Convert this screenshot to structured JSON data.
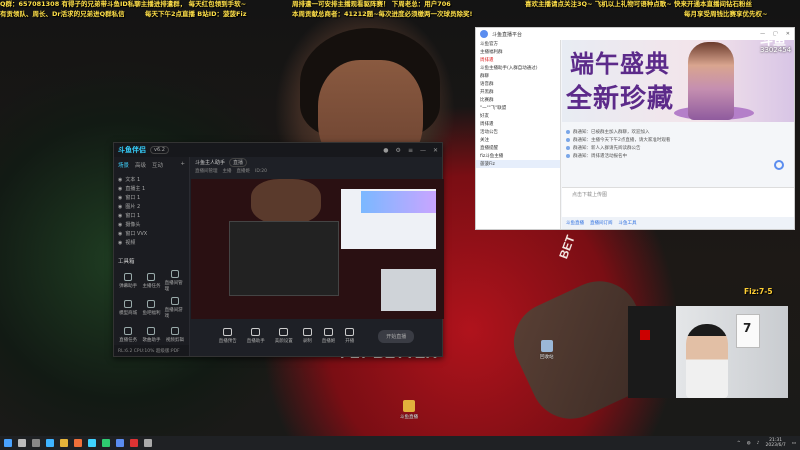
{
  "ticker": {
    "line1_left": "Q群：657081308 有得子的兄弟带斗鱼ID私聊主播进排遣群， 每天红包领到手软~",
    "line1_mid": "周排遣一可安排主播观看驱阵赛！ 下周老总：用户706",
    "line1_right": "喜欢主播请点关注3Q~ 飞机以上礼物可语种点歌~ 快来开通本直播间钻石粉丝",
    "line2_left": "有贡领队、周长、Dr活求的兄弟进Q群私信",
    "line2_mid": "每天下午2点直播 B站ID：菠菠Fiz",
    "line2_mid2": "本周贡献总商者：41212题~每次进度必须缴两一次球员除奖!",
    "line2_right": "每月享受周钱比赛享优先权~"
  },
  "app": {
    "logo": "斗鱼伴侣",
    "version": "v6.2",
    "tabs": [
      "场景",
      "高级",
      "互动"
    ],
    "scenes": [
      "文本 1",
      "直播主 1",
      "窗口 1",
      "图片 2",
      "窗口 1",
      "摄像头",
      "窗口 VVX",
      "视频"
    ],
    "tools_title": "工具箱",
    "tools": [
      {
        "label": "弹幕助手"
      },
      {
        "label": "主播任务"
      },
      {
        "label": "直播间管理"
      },
      {
        "label": "模型商城"
      },
      {
        "label": "鱼吧福利"
      },
      {
        "label": "直播间游戏"
      },
      {
        "label": "直播任务"
      },
      {
        "label": "歌曲助手"
      },
      {
        "label": "视频剪辑"
      }
    ],
    "status": "RL:6.2 CPU:10% 超级版:PDF",
    "main_title": "斗鱼主人助手",
    "main_tag": "直播",
    "main_sub": [
      "直播间管理",
      "主播",
      "直播姬",
      "ID:20"
    ],
    "bottom": [
      "直播预告",
      "直播助手",
      "美颜设置",
      "录制",
      "直播姬",
      "开播"
    ],
    "live_button": "开始直播"
  },
  "chat": {
    "title": "斗鱼直播平台",
    "list": [
      {
        "label": "斗鱼官方",
        "style": ""
      },
      {
        "label": "主播福利群",
        "style": ""
      },
      {
        "label": "周排遣",
        "style": "red"
      },
      {
        "label": "斗鱼主播助手(入群自动通过)",
        "style": ""
      },
      {
        "label": "群聊",
        "style": ""
      },
      {
        "label": "语音群",
        "style": ""
      },
      {
        "label": "开黑群",
        "style": ""
      },
      {
        "label": "比赛群",
        "style": ""
      },
      {
        "label": "\"一\"\"飞\"联盟",
        "style": ""
      },
      {
        "label": "好友",
        "style": ""
      },
      {
        "label": "周排遣",
        "style": ""
      },
      {
        "label": "活动公告",
        "style": ""
      },
      {
        "label": "关注",
        "style": ""
      },
      {
        "label": "直播提醒",
        "style": ""
      },
      {
        "label": "fiz斗鱼主播",
        "style": ""
      },
      {
        "label": "菠菠Fiz",
        "style": "sel"
      }
    ],
    "banner_line1": "端午盛典",
    "banner_line2": "全新珍藏",
    "badge_text": "斗鱼",
    "badge_number": "3302454",
    "messages": [
      "群通知：已被群主加入群聊，欢迎加入",
      "群通知：主播今天下午2点直播，请大家准时观看",
      "群通知：新人入群请先阅读群公告",
      "群通知：周排遣活动报名中"
    ],
    "input_placeholder": "点击下载上传图",
    "footer": [
      "斗鱼直播",
      "直播间订阅",
      "斗鱼工具"
    ]
  },
  "cam": {
    "badge": "Fiz:7-5",
    "shirt_number": "7"
  },
  "desktop_icons": [
    {
      "label": "斗鱼直播"
    },
    {
      "label": "回收站"
    }
  ],
  "taskbar": {
    "time": "21:31",
    "date": "2023/6/7"
  },
  "colors": {
    "accent": "#36d1ff",
    "ticker": "#ffe04a",
    "banner_text": "#5c2a8a"
  }
}
